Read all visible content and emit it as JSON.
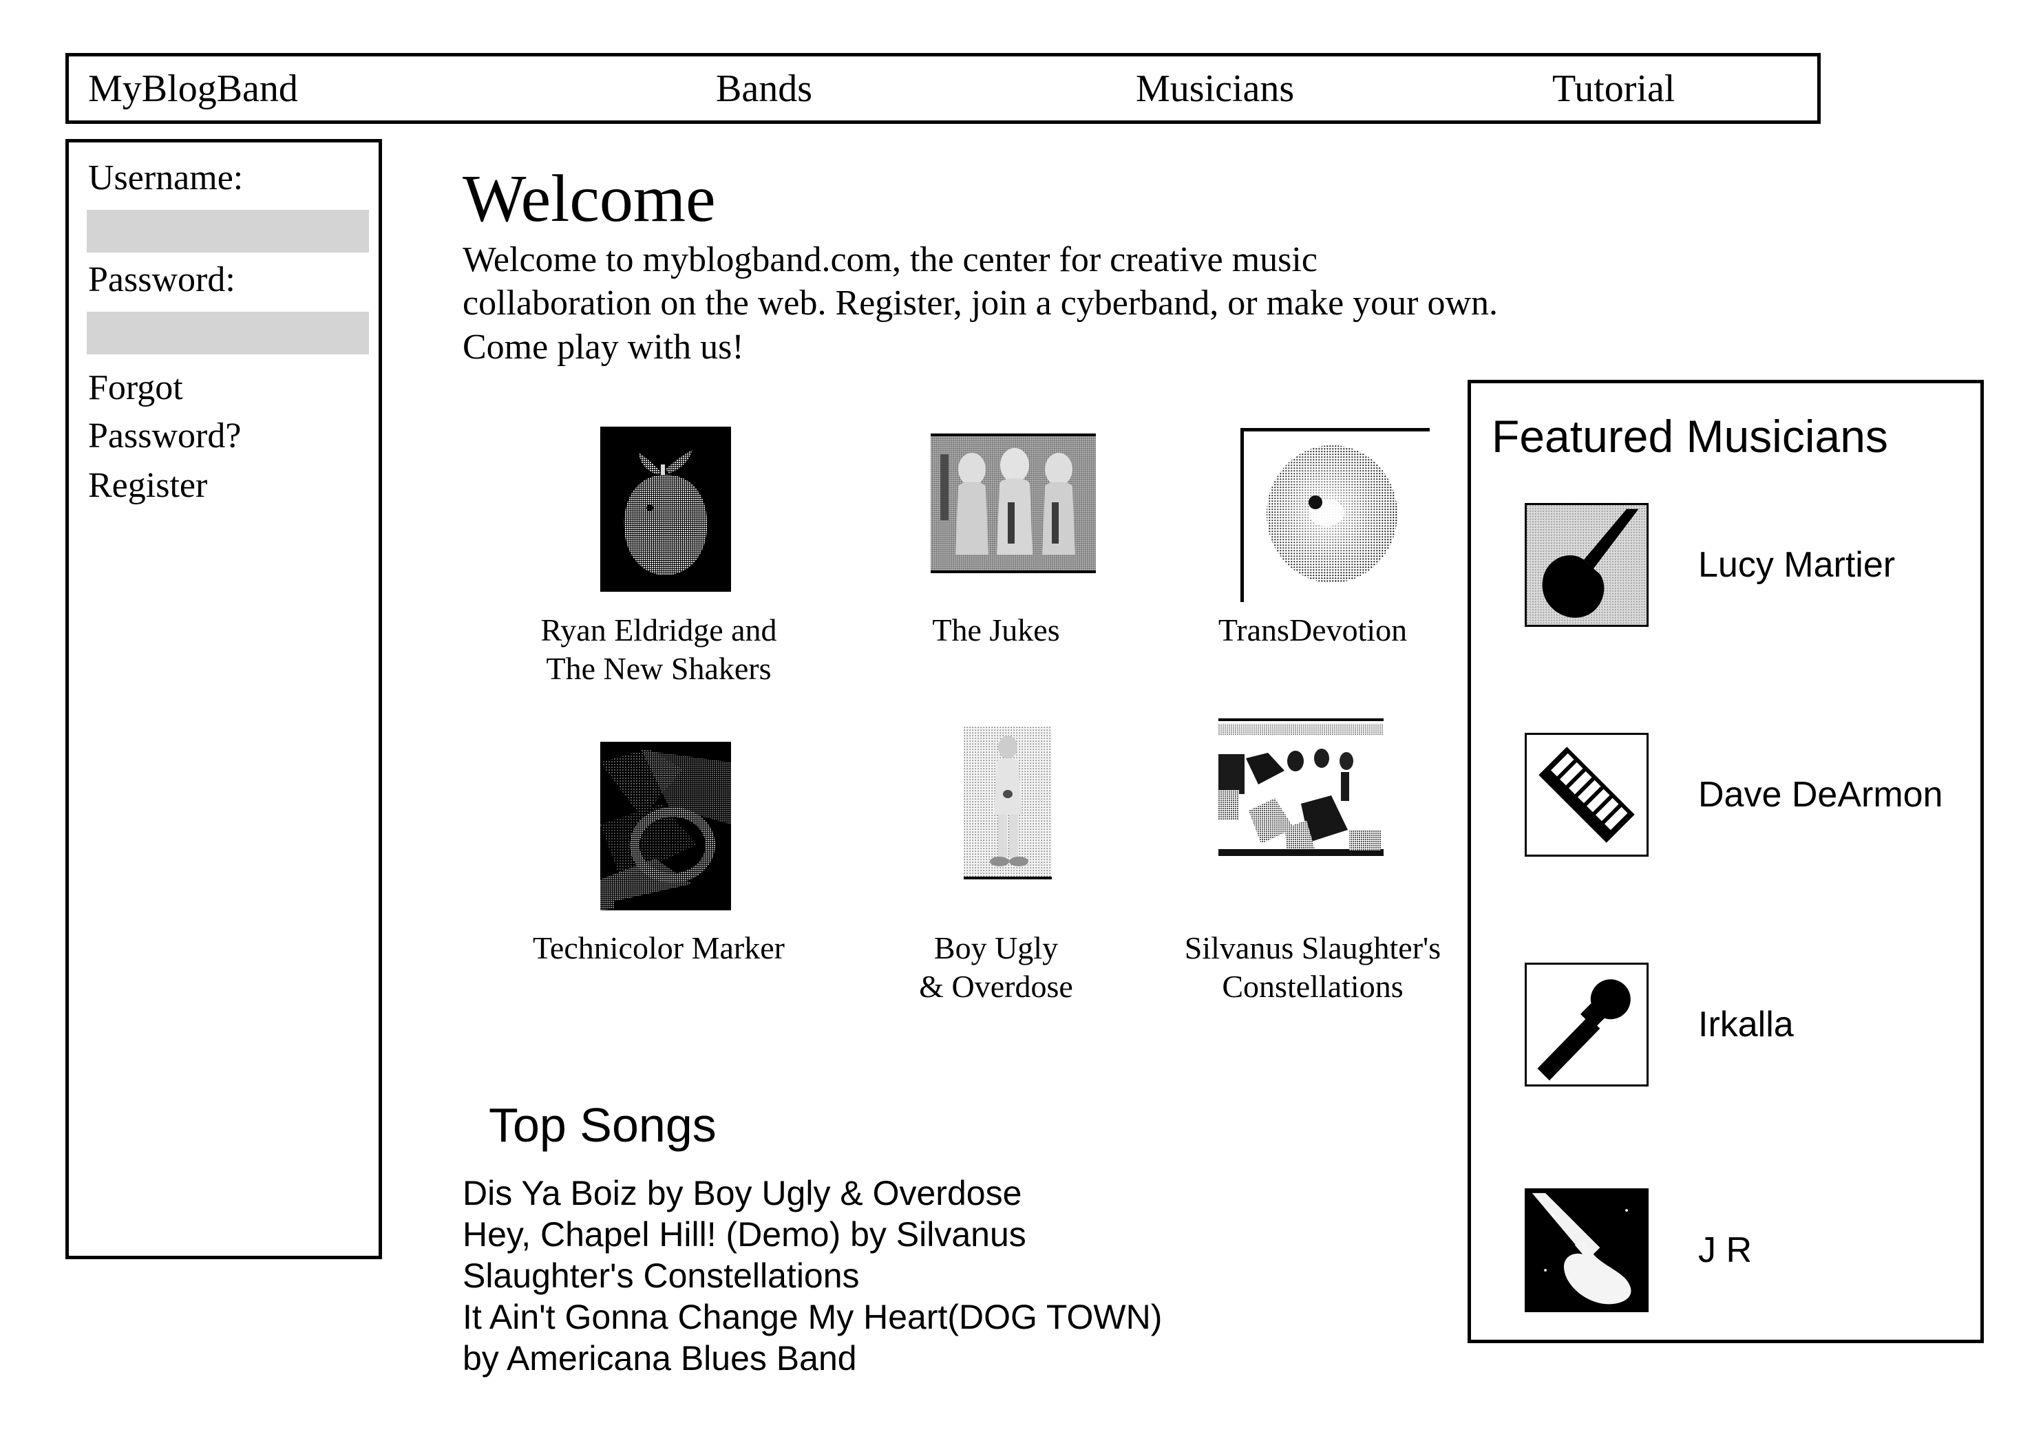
{
  "nav": {
    "brand": "MyBlogBand",
    "items": [
      {
        "label": "Bands"
      },
      {
        "label": "Musicians"
      },
      {
        "label": "Tutorial"
      }
    ]
  },
  "sidebar": {
    "username_label": "Username:",
    "username_value": "",
    "password_label": "Password:",
    "password_value": "",
    "forgot_line1": "Forgot",
    "forgot_line2": "Password?",
    "register": "Register"
  },
  "main": {
    "title": "Welcome",
    "intro": "Welcome to myblogband.com, the center for creative music collaboration on the web. Register, join a cyberband, or make your own. Come play with us!"
  },
  "bands": [
    {
      "name_line1": "Ryan Eldridge and",
      "name_line2": "The New Shakers",
      "image": "apple-on-black-thumbnail"
    },
    {
      "name_line1": "The Jukes",
      "name_line2": "",
      "image": "three-figures-gray-thumbnail"
    },
    {
      "name_line1": "TransDevotion",
      "name_line2": "",
      "image": "dithered-eye-thumbnail"
    },
    {
      "name_line1": "Technicolor Marker",
      "name_line2": "",
      "image": "dark-abstract-thumbnail"
    },
    {
      "name_line1": "Boy Ugly",
      "name_line2": "& Overdose",
      "image": "standing-figure-light-thumbnail"
    },
    {
      "name_line1": "Silvanus Slaughter's",
      "name_line2": "Constellations",
      "image": "band-photo-thumbnail"
    }
  ],
  "top_songs": {
    "title": "Top Songs",
    "lines": [
      "Dis Ya Boiz by Boy Ugly & Overdose",
      "Hey, Chapel Hill! (Demo) by Silvanus",
      "Slaughter's Constellations",
      "It Ain't Gonna Change My Heart(DOG TOWN)",
      "by Americana Blues Band"
    ]
  },
  "featured": {
    "title": "Featured Musicians",
    "musicians": [
      {
        "name": "Lucy Martier",
        "icon": "acoustic-guitar-icon"
      },
      {
        "name": "Dave DeArmon",
        "icon": "keyboard-piano-icon"
      },
      {
        "name": "Irkalla",
        "icon": "microphone-icon"
      },
      {
        "name": "J R",
        "icon": "electric-guitar-icon"
      }
    ]
  },
  "colors": {
    "border": "#000000",
    "input_fill": "#d4d4d4",
    "page_bg": "#ffffff"
  }
}
